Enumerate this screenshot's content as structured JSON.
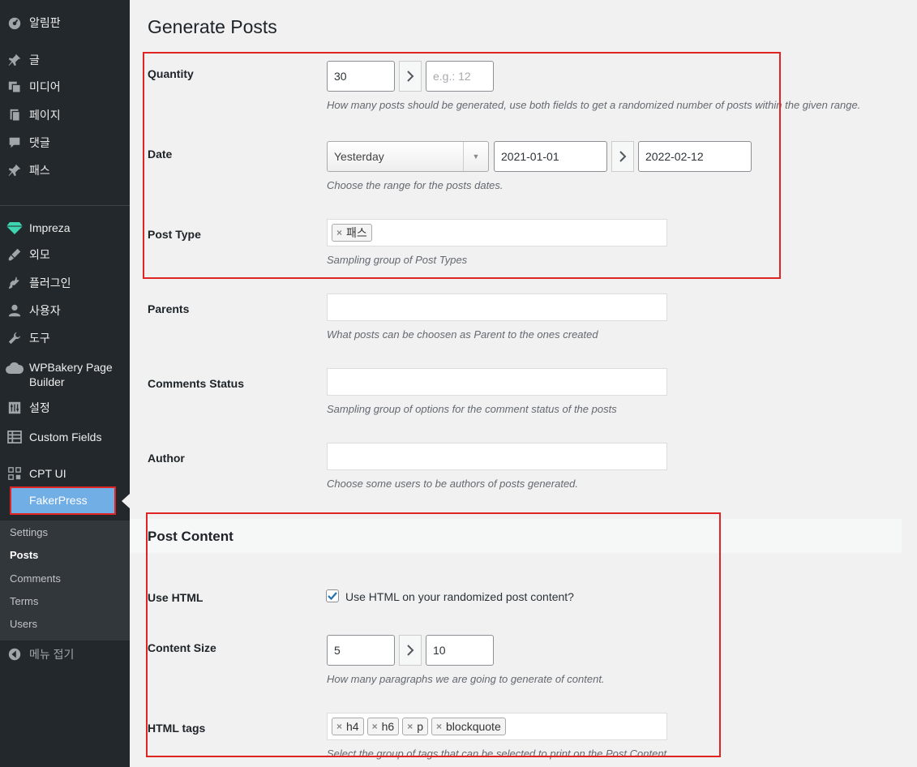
{
  "sidebar": {
    "items": [
      {
        "label": "알림판",
        "icon": "dashboard-icon"
      },
      {
        "label": "글",
        "icon": "pin-icon"
      },
      {
        "label": "미디어",
        "icon": "media-icon"
      },
      {
        "label": "페이지",
        "icon": "page-icon"
      },
      {
        "label": "댓글",
        "icon": "comment-icon"
      },
      {
        "label": "패스",
        "icon": "pin-icon"
      },
      {
        "label": "Impreza",
        "icon": "diamond-icon"
      },
      {
        "label": "외모",
        "icon": "brush-icon"
      },
      {
        "label": "플러그인",
        "icon": "plugin-icon"
      },
      {
        "label": "사용자",
        "icon": "user-icon"
      },
      {
        "label": "도구",
        "icon": "wrench-icon"
      },
      {
        "label": "WPBakery Page Builder",
        "icon": "cloud-icon"
      },
      {
        "label": "설정",
        "icon": "settings-icon"
      },
      {
        "label": "Custom Fields",
        "icon": "table-icon"
      },
      {
        "label": "CPT UI",
        "icon": "grid-icon"
      }
    ],
    "fakerpress": "FakerPress",
    "submenu": [
      "Settings",
      "Posts",
      "Comments",
      "Terms",
      "Users"
    ],
    "active_submenu": "Posts",
    "collapse": "메뉴 접기"
  },
  "page": {
    "title": "Generate Posts",
    "quantity": {
      "label": "Quantity",
      "min": "30",
      "max_placeholder": "e.g.: 12",
      "description": "How many posts should be generated, use both fields to get a randomized number of posts within the given range."
    },
    "date": {
      "label": "Date",
      "select": "Yesterday",
      "from": "2021-01-01",
      "to": "2022-02-12",
      "description": "Choose the range for the posts dates."
    },
    "post_type": {
      "label": "Post Type",
      "tags": [
        "패스"
      ],
      "description": "Sampling group of Post Types"
    },
    "parents": {
      "label": "Parents",
      "description": "What posts can be choosen as Parent to the ones created"
    },
    "comments_status": {
      "label": "Comments Status",
      "description": "Sampling group of options for the comment status of the posts"
    },
    "author": {
      "label": "Author",
      "description": "Choose some users to be authors of posts generated."
    }
  },
  "post_content": {
    "title": "Post Content",
    "use_html": {
      "label": "Use HTML",
      "checkbox_text": "Use HTML on your randomized post content?",
      "checked": true
    },
    "content_size": {
      "label": "Content Size",
      "min": "5",
      "max": "10",
      "description": "How many paragraphs we are going to generate of content."
    },
    "html_tags": {
      "label": "HTML tags",
      "tags": [
        "h4",
        "h6",
        "p",
        "blockquote"
      ],
      "description": "Select the group of tags that can be selected to print on the Post Content"
    }
  },
  "colors": {
    "sidebar_bg": "#23282d",
    "highlight": "#72aee6",
    "annotation": "#e02424"
  }
}
